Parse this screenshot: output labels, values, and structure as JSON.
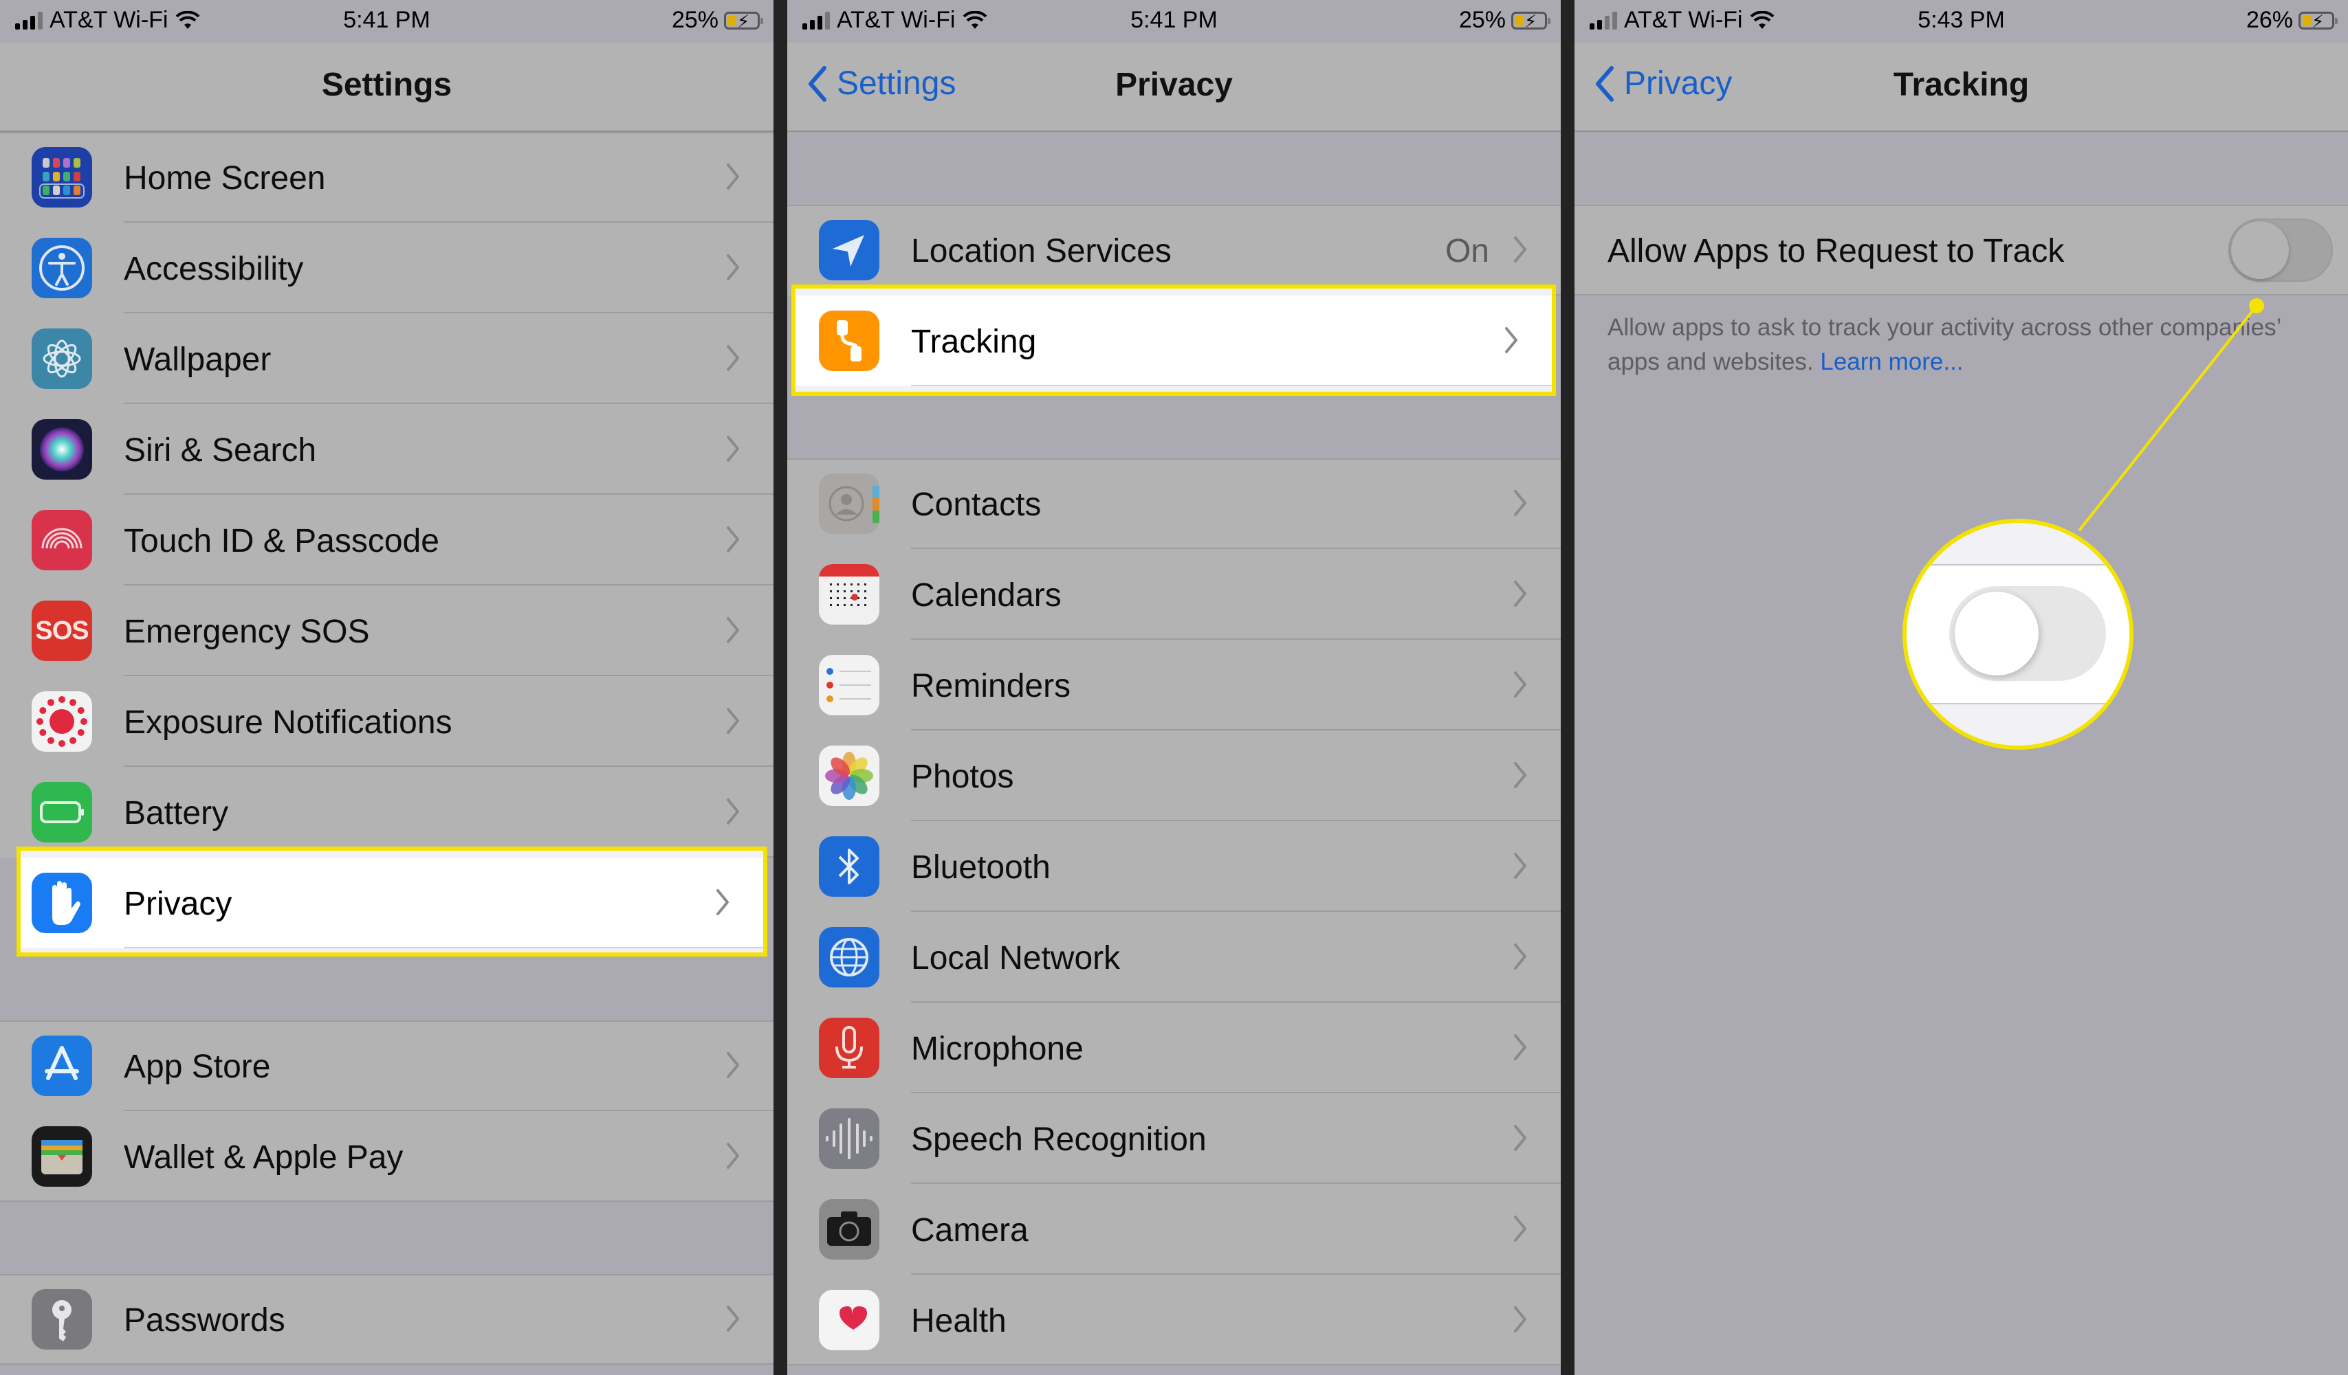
{
  "panels": [
    {
      "status": {
        "carrier": "AT&T Wi-Fi",
        "time": "5:41 PM",
        "battery": "25%"
      },
      "nav": {
        "title": "Settings",
        "back": null
      },
      "groups": [
        [
          {
            "label": "Home Screen",
            "icon": "home-screen-icon"
          },
          {
            "label": "Accessibility",
            "icon": "accessibility-icon"
          },
          {
            "label": "Wallpaper",
            "icon": "wallpaper-icon"
          },
          {
            "label": "Siri & Search",
            "icon": "siri-icon"
          },
          {
            "label": "Touch ID & Passcode",
            "icon": "fingerprint-icon"
          },
          {
            "label": "Emergency SOS",
            "icon": "sos-icon",
            "icon_text": "SOS"
          },
          {
            "label": "Exposure Notifications",
            "icon": "exposure-notifications-icon"
          },
          {
            "label": "Battery",
            "icon": "battery-icon"
          },
          {
            "label": "Privacy",
            "icon": "privacy-hand-icon",
            "highlighted": true
          }
        ],
        [
          {
            "label": "App Store",
            "icon": "app-store-icon"
          },
          {
            "label": "Wallet & Apple Pay",
            "icon": "wallet-icon"
          }
        ],
        [
          {
            "label": "Passwords",
            "icon": "key-icon"
          }
        ]
      ]
    },
    {
      "status": {
        "carrier": "AT&T Wi-Fi",
        "time": "5:41 PM",
        "battery": "25%"
      },
      "nav": {
        "title": "Privacy",
        "back": "Settings"
      },
      "groups": [
        [
          {
            "label": "Location Services",
            "icon": "location-arrow-icon",
            "value": "On"
          },
          {
            "label": "Tracking",
            "icon": "tracking-icon",
            "highlighted": true
          }
        ],
        [
          {
            "label": "Contacts",
            "icon": "contacts-icon"
          },
          {
            "label": "Calendars",
            "icon": "calendar-icon"
          },
          {
            "label": "Reminders",
            "icon": "reminders-icon"
          },
          {
            "label": "Photos",
            "icon": "photos-icon"
          },
          {
            "label": "Bluetooth",
            "icon": "bluetooth-icon"
          },
          {
            "label": "Local Network",
            "icon": "globe-icon"
          },
          {
            "label": "Microphone",
            "icon": "microphone-icon"
          },
          {
            "label": "Speech Recognition",
            "icon": "waveform-icon"
          },
          {
            "label": "Camera",
            "icon": "camera-icon"
          },
          {
            "label": "Health",
            "icon": "heart-icon"
          }
        ]
      ]
    },
    {
      "status": {
        "carrier": "AT&T Wi-Fi",
        "time": "5:43 PM",
        "battery": "26%"
      },
      "nav": {
        "title": "Tracking",
        "back": "Privacy"
      },
      "setting": {
        "label": "Allow Apps to Request to Track",
        "enabled": false
      },
      "footnote": {
        "text": "Allow apps to ask to track your activity across other companies’ apps and websites. ",
        "link": "Learn more..."
      }
    }
  ],
  "colors": {
    "highlight": "#f4e300",
    "link": "#1a5fc9"
  }
}
